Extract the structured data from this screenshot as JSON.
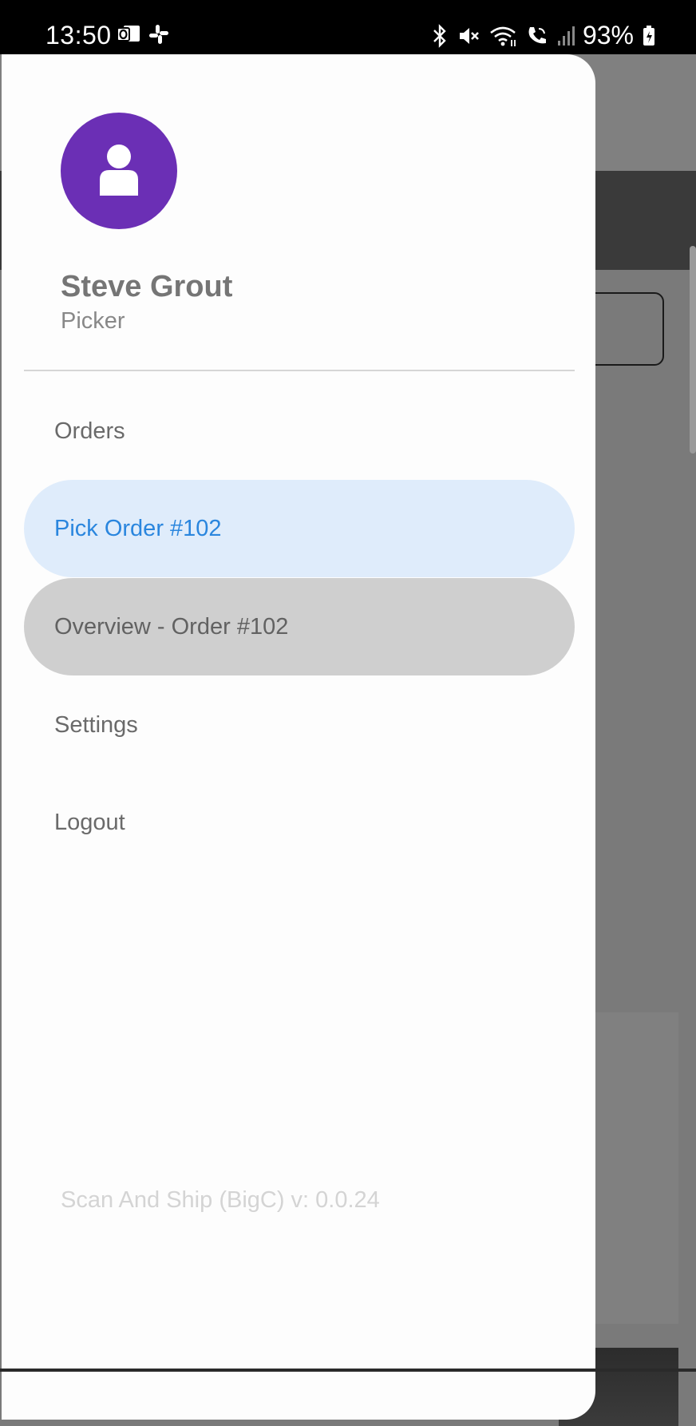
{
  "status_bar": {
    "time": "13:50",
    "left_icons": [
      "outlook-icon",
      "slack-icon"
    ],
    "right_icons": [
      "bluetooth-icon",
      "mute-icon",
      "wifi-icon",
      "wifi-calling-icon",
      "signal-icon",
      "battery-icon"
    ],
    "battery": "93%"
  },
  "drawer": {
    "avatar_icon": "person-icon",
    "avatar_color": "#6b2fb5",
    "user_name": "Steve Grout",
    "user_role": "Picker",
    "menu": [
      {
        "label": "Orders",
        "state": "normal"
      },
      {
        "label": "Pick Order #102",
        "state": "selected"
      },
      {
        "label": "Overview - Order #102",
        "state": "pressed"
      },
      {
        "label": "Settings",
        "state": "normal"
      },
      {
        "label": "Logout",
        "state": "normal"
      }
    ],
    "version": "Scan And Ship (BigC) v: 0.0.24"
  },
  "colors": {
    "selected_bg": "#dfecfb",
    "selected_text": "#2a86de",
    "pressed_bg": "#cfcfcf"
  }
}
